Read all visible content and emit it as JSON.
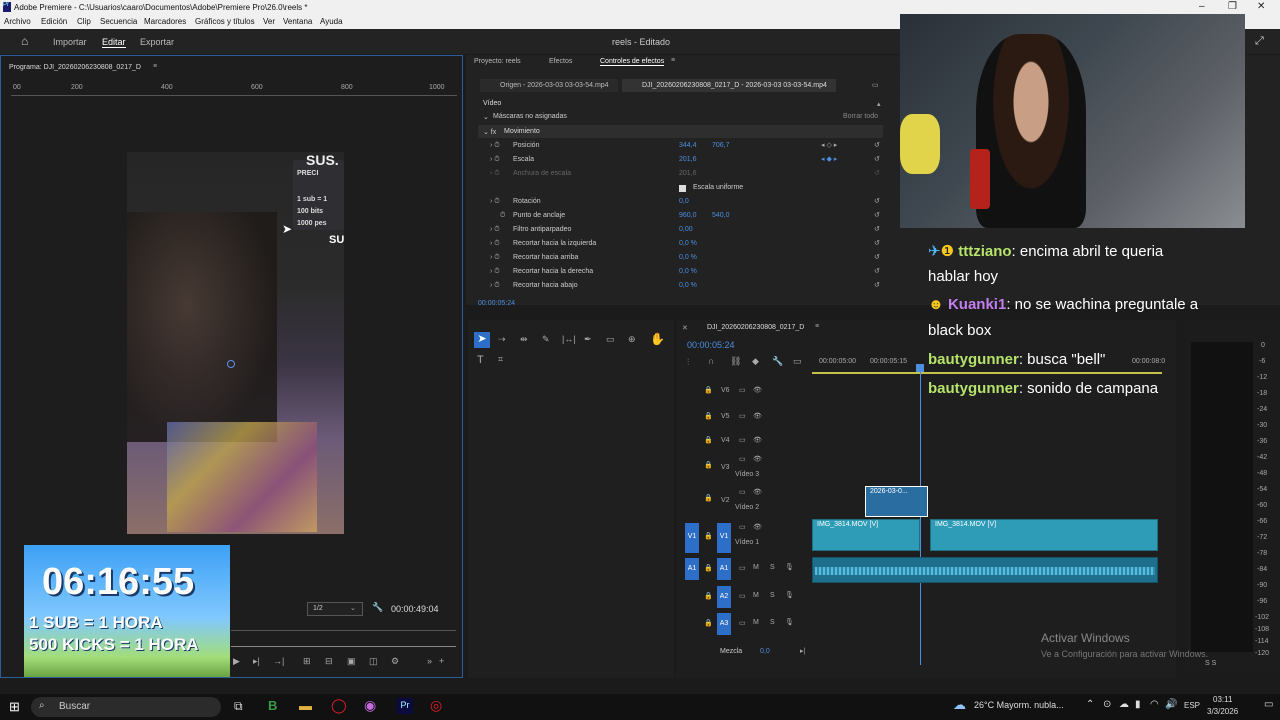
{
  "title": "Adobe Premiere - C:\\Usuarios\\caaro\\Documentos\\Adobe\\Premiere Pro\\26.0\\reels *",
  "menu": [
    "Archivo",
    "Edición",
    "Clip",
    "Secuencia",
    "Marcadores",
    "Gráficos y títulos",
    "Ver",
    "Ventana",
    "Ayuda"
  ],
  "header": {
    "import": "Importar",
    "edit": "Editar",
    "export": "Exportar",
    "project": "reels - Editado"
  },
  "program": {
    "label": "Programa: DJI_20260206230808_0217_D",
    "ruler": [
      "00",
      "200",
      "400",
      "600",
      "800",
      "1000"
    ],
    "res": "1/2",
    "timecode": "00:00:49:04"
  },
  "panels": {
    "tabs": [
      "Proyecto: reels",
      "Efectos",
      "Controles de efectos"
    ],
    "source": "Origen - 2026-03-03 03-03-54.mp4",
    "seq": "DJI_20260206230808_0217_D - 2026-03-03 03-03-54.mp4"
  },
  "effects": {
    "video": "Vídeo",
    "masks": "Máscaras no asignadas",
    "clear": "Borrar todo",
    "motion": "Movimiento",
    "rows": [
      {
        "name": "Posición",
        "v1": "344,4",
        "v2": "706,7"
      },
      {
        "name": "Escala",
        "v1": "201,6",
        "v2": ""
      },
      {
        "name": "Anchura de escala",
        "v1": "201,6",
        "v2": ""
      },
      {
        "name": "Escala uniforme",
        "v1": "",
        "v2": ""
      },
      {
        "name": "Rotación",
        "v1": "0,0",
        "v2": ""
      },
      {
        "name": "Punto de anclaje",
        "v1": "960,0",
        "v2": "540,0"
      },
      {
        "name": "Filtro antiparpadeo",
        "v1": "0,00",
        "v2": ""
      },
      {
        "name": "Recortar hacia la izquierda",
        "v1": "0,0 %",
        "v2": ""
      },
      {
        "name": "Recortar hacia arriba",
        "v1": "0,0 %",
        "v2": ""
      },
      {
        "name": "Recortar hacia la derecha",
        "v1": "0,0 %",
        "v2": ""
      },
      {
        "name": "Recortar hacia abajo",
        "v1": "0,0 %",
        "v2": ""
      }
    ],
    "timecode": "00:00:05:24"
  },
  "timeline": {
    "name": "DJI_20260206230808_0217_D",
    "timecode": "00:00:05:24",
    "ruler": [
      "00:00:05:00",
      "00:00:05:15",
      "00:00:08:0"
    ],
    "tracks": [
      "V6",
      "V5",
      "V4",
      "V3",
      "V2",
      "V1",
      "A1",
      "A2",
      "A3"
    ],
    "video3": "Vídeo 3",
    "video2": "Vídeo 2",
    "video1": "Vídeo 1",
    "clip_v2": "2026-03-0...",
    "clip1": "IMG_3814.MOV [V]",
    "clip2": "IMG_3814.MOV [V]",
    "mix": "Mezcla",
    "mixval": "0,0",
    "meter": [
      "0",
      "-6",
      "-12",
      "-18",
      "-24",
      "-30",
      "-36",
      "-42",
      "-48",
      "-54",
      "-60",
      "-66",
      "-72",
      "-78",
      "-84",
      "-90",
      "-96",
      "-102",
      "-108",
      "-114",
      "-120"
    ],
    "meter_footer": "S  S"
  },
  "chat": [
    {
      "user": "tttziano",
      "msg": ": encima abril te queria"
    },
    {
      "user": "",
      "msg": "hablar hoy"
    },
    {
      "user": "Kuanki1",
      "msg": ": no se wachina preguntale a"
    },
    {
      "user": "",
      "msg": "black box"
    },
    {
      "user": "bautygunner",
      "msg": ": busca \"bell\""
    },
    {
      "user": "bautygunner",
      "msg": ": sonido de campana"
    }
  ],
  "timer": {
    "time": "06:16:55",
    "line1": "1 SUB = 1 HORA",
    "line2": "500 KICKS = 1 HORA"
  },
  "overlay_text": [
    "SUS.",
    "PRECI",
    "1 sub = 1",
    "100 bits",
    "1000 pes",
    "SU"
  ],
  "watermark": {
    "l1": "Activar Windows",
    "l2": "Ve a Configuración para activar Windows."
  },
  "taskbar": {
    "search": "Buscar",
    "weather": "26°C  Mayorm. nubla...",
    "lang": "ESP",
    "time": "03:11",
    "date": "3/3/2026"
  }
}
